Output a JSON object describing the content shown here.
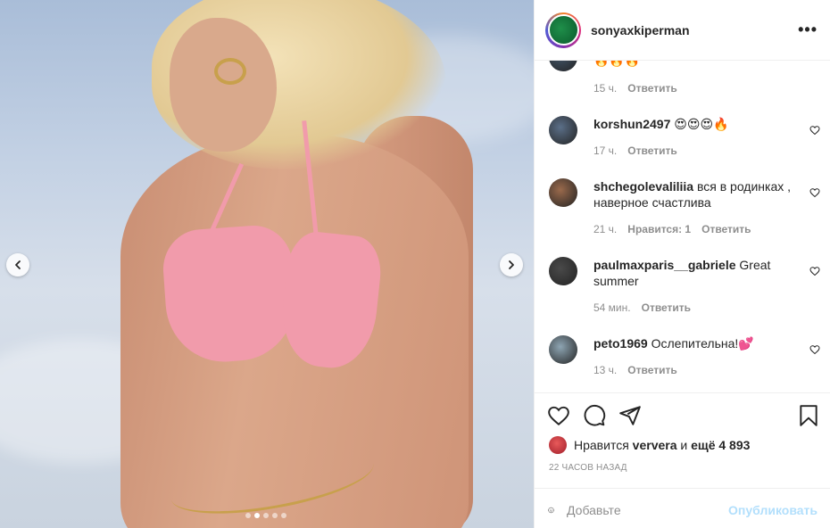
{
  "post": {
    "username": "sonyaxkiperman",
    "more_label": "•••",
    "carousel": {
      "total": 5,
      "active_index": 1
    }
  },
  "comments": [
    {
      "user": "",
      "text": "🔥🔥🔥",
      "time": "15 ч.",
      "likes": "",
      "reply": "Ответить",
      "avatar_color": "#44576b"
    },
    {
      "user": "korshun2497",
      "text": "😍😍😍🔥",
      "time": "17 ч.",
      "likes": "",
      "reply": "Ответить",
      "avatar_color": "#5b6f88"
    },
    {
      "user": "shchegolevaliliia",
      "text": "вся в родинках , наверное счастлива",
      "time": "21 ч.",
      "likes": "Нравится: 1",
      "reply": "Ответить",
      "avatar_color": "#9a6a4c"
    },
    {
      "user": "paulmaxparis__gabriele",
      "text": "Great summer",
      "time": "54 мин.",
      "likes": "",
      "reply": "Ответить",
      "avatar_color": "#4a4a4a"
    },
    {
      "user": "peto1969",
      "text": "Ослепительна!💕",
      "time": "13 ч.",
      "likes": "",
      "reply": "Ответить",
      "avatar_color": "#8ea5b3"
    }
  ],
  "actions": {
    "likes_prefix": "Нравится",
    "liked_by": "ververa",
    "likes_joiner": "и",
    "likes_more": "ещё 4 893",
    "timestamp": "22 ЧАСОВ НАЗАД"
  },
  "composer": {
    "placeholder": "Добавьте",
    "publish_label": "Опубликовать"
  }
}
